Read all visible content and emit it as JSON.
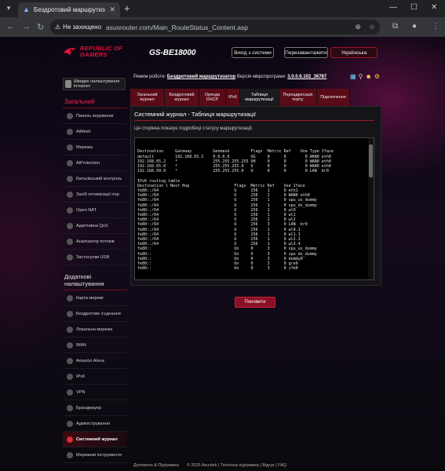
{
  "browser": {
    "tab_title": "Бездротовий маршрутизатор A",
    "security_label": "Не захищено",
    "url": "asusrouter.com/Main_RouteStatus_Content.asp"
  },
  "header": {
    "brand_line1": "REPUBLIC OF",
    "brand_line2": "GAMERS",
    "model": "GS-BE18000",
    "logout_label": "Вихід з системи",
    "reboot_label": "Перезавантажити",
    "language_label": "Українська"
  },
  "status": {
    "mode_label": "Режим роботи:",
    "mode_value": "Бездротовий маршрутизатор",
    "firmware_label": "Версія мікропрограми:",
    "firmware_value": "3.0.0.6.102_36787"
  },
  "sidebar": {
    "qis_label": "Швидке налаштування Інтернет",
    "general_title": "Загальний",
    "general_items": [
      "Панель керування",
      "AiMesh",
      "Мережа",
      "AiProtection",
      "Батьківський контроль",
      "Засіб оптимізації ігор",
      "Open NAT",
      "Адаптивна QoS",
      "Аналізатор потоків",
      "Застосунки USB"
    ],
    "advanced_title": "Додаткові налаштування",
    "advanced_items": [
      "Карта мережі",
      "Бездротове з'єднання",
      "Локальна мережа",
      "WAN",
      "Amazon Alexa",
      "IPv6",
      "VPN",
      "Брандмауер",
      "Адміністрування",
      "Системний журнал",
      "Мережеві інструменти"
    ]
  },
  "tabs": [
    "Загальний журнал",
    "Бездротовий журнал",
    "Оренда DHCP",
    "IPv6",
    "Таблиця маршрутизації",
    "Переадресація порту",
    "Підключення"
  ],
  "main": {
    "title": "Системний журнал - Таблиця маршрутизації",
    "description": "Ця сторінка показує подробиці статусу маршрутизації.",
    "refresh_label": "Поновити",
    "log_lines": [
      "Destination     Gateway         Genmask         Flags  Metric Ref    Use Type Iface",
      "default         192.168.65.2    0.0.0.0         UG     0      0        0 WAN0 eth0",
      "192.168.65.2    *               255.255.255.255 UH     0      0        0 WAN0 eth0",
      "192.168.65.0    *               255.255.255.0   U      0      0        0 WAN0 eth0",
      "192.168.50.0    *               255.255.255.0   U      0      0        0 LAN  br0",
      "",
      "IPv6 routing table",
      "Destination l Next Hop                   Flags  Metric Ref    Use Iface",
      "fe80::/64                                U      256    1      0 eth1",
      "fe80::/64                                U      256    1      0 WAN0 eth0",
      "fe80::/64                                U      256    1      0 spu_us_dummy",
      "fe80::/64                                U      256    1      0 spu_ds_dummy",
      "fe80::/64                                U      256    1      0 wl0",
      "fe80::/64                                U      256    1      0 wl1",
      "fe80::/64                                U      256    1      0 wl2",
      "fe80::/64                                U      256    3      0 LAN  br0",
      "fe80::/64                                U      256    1      0 wl0.1",
      "fe80::/64                                U      256    1      0 wl1.1",
      "fe80::/64                                U      256    1      0 wl2.1",
      "fe80::/64                                U      256    1      0 wl3.4",
      "fe80::                                   Un     0      3      0 spu_us_dummy",
      "fe80::                                   Un     0      3      0 spu_ds_dummy",
      "fe80::                                   Un     0      3      0 dummy0",
      "fe80::                                   Un     0      3      0 gre0",
      "fe80::                                   Un     0      3      0 ifb0"
    ]
  },
  "footer": {
    "help_label": "Допомога & Підтримка",
    "copyright": "© 2025 Asustek | Технічна підтримка | Відгук | FAQ"
  }
}
